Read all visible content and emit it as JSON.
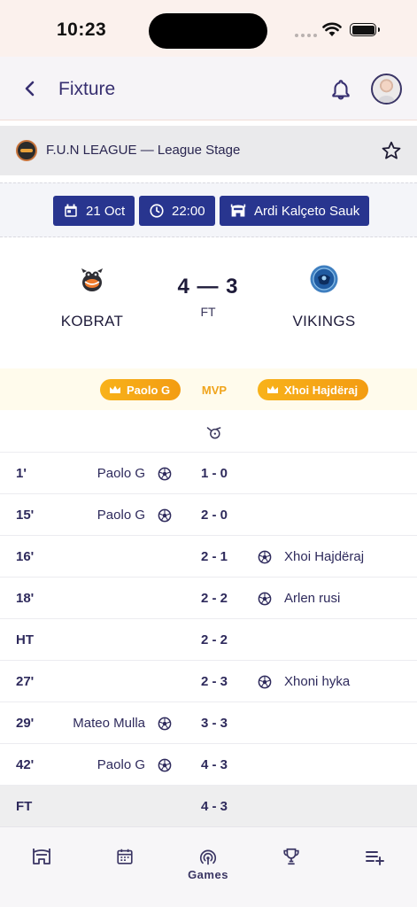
{
  "status_bar": {
    "time": "10:23"
  },
  "header": {
    "title": "Fixture"
  },
  "league": {
    "name": "F.U.N LEAGUE — League Stage"
  },
  "match_info": {
    "date": "21 Oct",
    "time": "22:00",
    "venue": "Ardi Kalçeto Sauk"
  },
  "match": {
    "home_team": "KOBRAT",
    "away_team": "VIKINGS",
    "score": "4 — 3",
    "status": "FT"
  },
  "mvp": {
    "home": "Paolo G",
    "label": "MVP",
    "away": "Xhoi Hajdëraj"
  },
  "events": [
    {
      "minute": "1'",
      "home": "Paolo G",
      "result": "1 - 0",
      "away": ""
    },
    {
      "minute": "15'",
      "home": "Paolo G",
      "result": "2 - 0",
      "away": ""
    },
    {
      "minute": "16'",
      "home": "",
      "result": "2 - 1",
      "away": "Xhoi Hajdëraj"
    },
    {
      "minute": "18'",
      "home": "",
      "result": "2 - 2",
      "away": "Arlen rusi"
    },
    {
      "minute": "HT",
      "home": "",
      "result": "2 - 2",
      "away": ""
    },
    {
      "minute": "27'",
      "home": "",
      "result": "2 - 3",
      "away": "Xhoni hyka"
    },
    {
      "minute": "29'",
      "home": "Mateo Mulla",
      "result": "3 - 3",
      "away": ""
    },
    {
      "minute": "42'",
      "home": "Paolo G",
      "result": "4 - 3",
      "away": ""
    },
    {
      "minute": "FT",
      "home": "",
      "result": "4 - 3",
      "away": ""
    }
  ],
  "bottom_nav": {
    "items": [
      {
        "icon": "stadium-icon",
        "label": ""
      },
      {
        "icon": "calendar-icon",
        "label": ""
      },
      {
        "icon": "games-icon",
        "label": "Games"
      },
      {
        "icon": "trophy-icon",
        "label": ""
      },
      {
        "icon": "playlist-add-icon",
        "label": ""
      }
    ]
  },
  "colors": {
    "primary": "#28358f",
    "text": "#2e2a5c",
    "mvp_gold": "#f5a623"
  }
}
